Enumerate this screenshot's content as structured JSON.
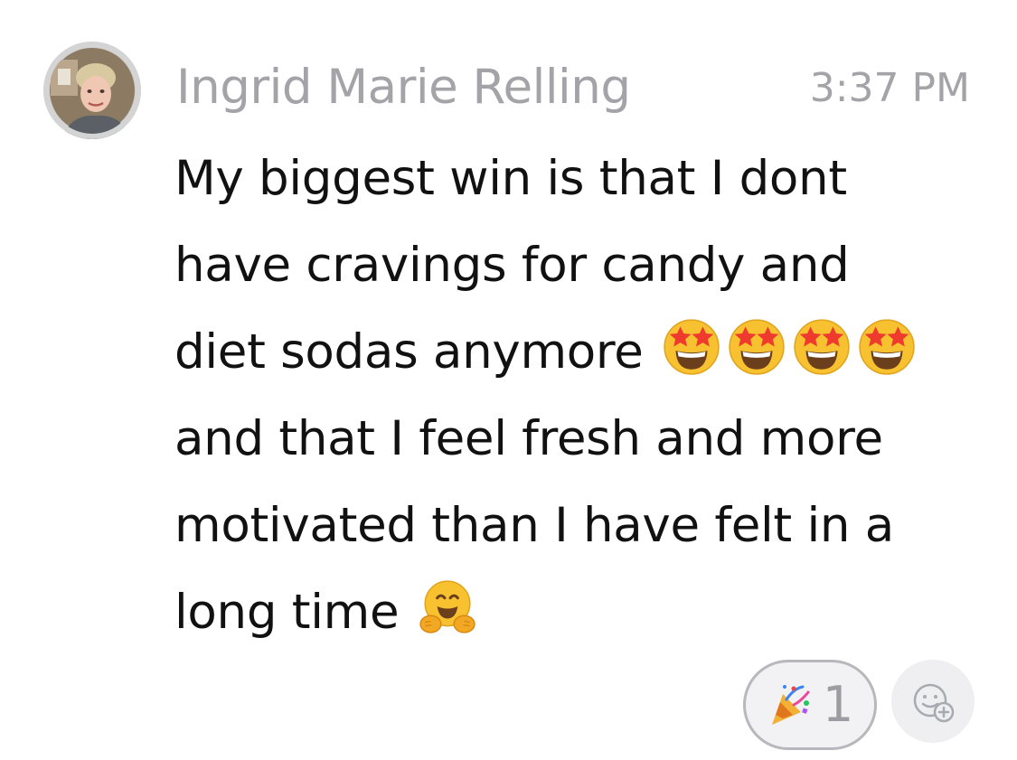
{
  "message": {
    "author": "Ingrid Marie Relling",
    "time": "3:37 PM",
    "lines": [
      "My biggest win is that I dont",
      "have cravings for candy and",
      "diet sodas anymore",
      "and that I feel fresh and more",
      "motivated than I have felt in a",
      "long time"
    ],
    "inline_emojis": {
      "line_3": [
        "star-struck-emoji",
        "star-struck-emoji",
        "star-struck-emoji",
        "star-struck-emoji"
      ],
      "line_6": [
        "hugging-face-emoji"
      ]
    }
  },
  "reactions": [
    {
      "emoji": "party-popper-emoji",
      "count": "1"
    }
  ],
  "add_reaction": {
    "icon": "add-reaction-icon"
  },
  "colors": {
    "meta_text": "#a3a3a8",
    "body_text": "#111111",
    "pill_border": "#b8b8bc",
    "pill_background": "#f2f2f4",
    "emoji_yellow": "#f7c12f"
  }
}
